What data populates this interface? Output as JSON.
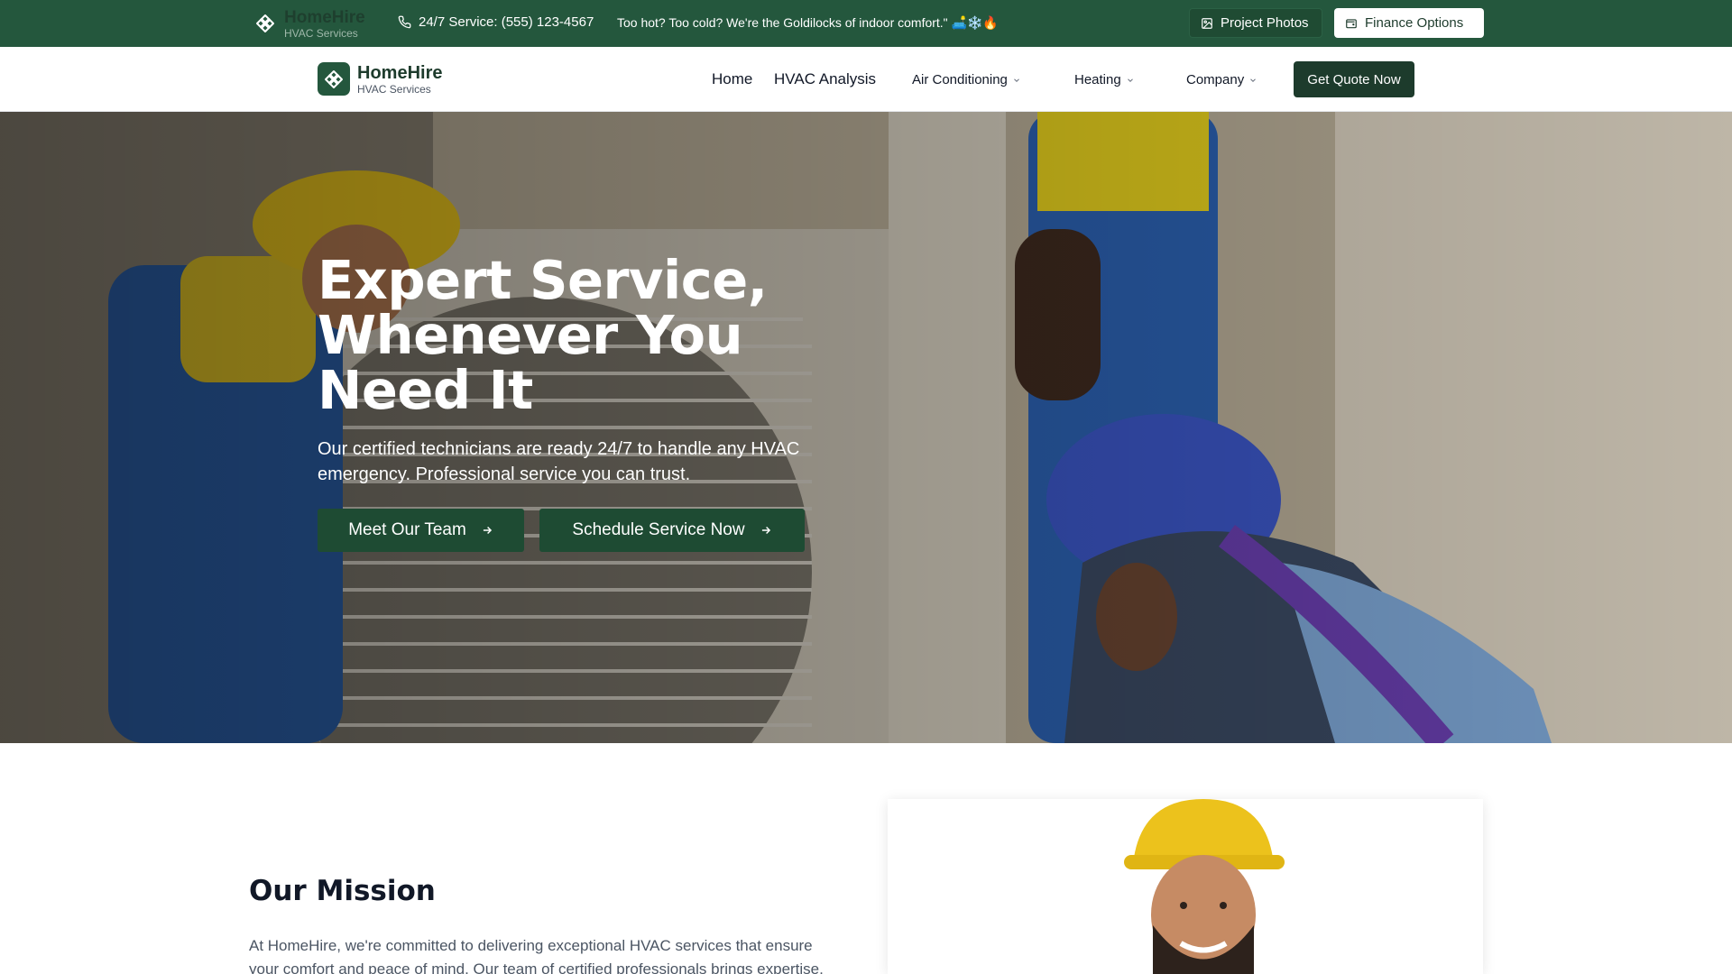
{
  "colors": {
    "brand": "#24573d",
    "brand_dark": "#1d3b2c",
    "hero_button": "#1e4b33"
  },
  "topbar": {
    "brand_name": "HomeHire",
    "brand_sub": "HVAC Services",
    "phone": "24/7 Service: (555) 123-4567",
    "message": "Too hot? Too cold? We're the Goldilocks of indoor comfort.\" 🛋️❄️🔥",
    "photos_label": "Project Photos",
    "finance_label": "Finance Options",
    "icons": {
      "logo": "hvac-logo-icon",
      "phone": "phone-icon",
      "photos": "image-icon",
      "finance": "wallet-icon"
    }
  },
  "nav": {
    "brand_name": "HomeHire",
    "brand_sub": "HVAC Services",
    "links": [
      "Home",
      "HVAC Analysis",
      "Air Conditioning",
      "Heating",
      "Company"
    ],
    "cta_label": "Get Quote Now"
  },
  "hero": {
    "title": "Expert Service, Whenever You Need It",
    "subtitle": "Our certified technicians are ready 24/7 to handle any HVAC emergency. Professional service you can trust.",
    "button_team": "Meet Our Team",
    "button_schedule": "Schedule Service Now"
  },
  "mission": {
    "title": "Our Mission",
    "text": "At HomeHire, we're committed to delivering exceptional HVAC services that ensure your comfort and peace of mind. Our team of certified professionals brings expertise,"
  }
}
